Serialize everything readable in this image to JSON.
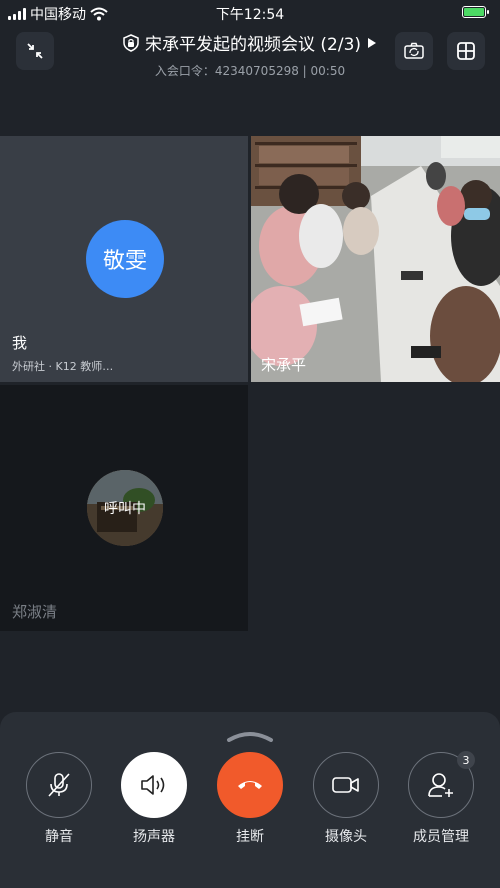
{
  "status_bar": {
    "carrier": "中国移动",
    "time": "下午12:54"
  },
  "header": {
    "title": "宋承平发起的视频会议 (2/3)",
    "subtitle": "入会口令：42340705298 | 00:50"
  },
  "participants": [
    {
      "name": "我",
      "avatar_text": "敬雯",
      "org": "外研社 · K12 教师…"
    },
    {
      "name": "宋承平"
    },
    {
      "name": "郑淑清",
      "status": "呼叫中"
    }
  ],
  "controls": [
    {
      "label": "静音",
      "icon": "mic-off-icon"
    },
    {
      "label": "扬声器",
      "icon": "speaker-icon"
    },
    {
      "label": "挂断",
      "icon": "hangup-icon"
    },
    {
      "label": "摄像头",
      "icon": "camera-icon"
    },
    {
      "label": "成员管理",
      "icon": "add-member-icon",
      "badge": "3"
    }
  ],
  "colors": {
    "background": "#1f2329",
    "avatar": "#3d8bf5",
    "hangup": "#f15a2b",
    "battery": "#4cd964"
  }
}
